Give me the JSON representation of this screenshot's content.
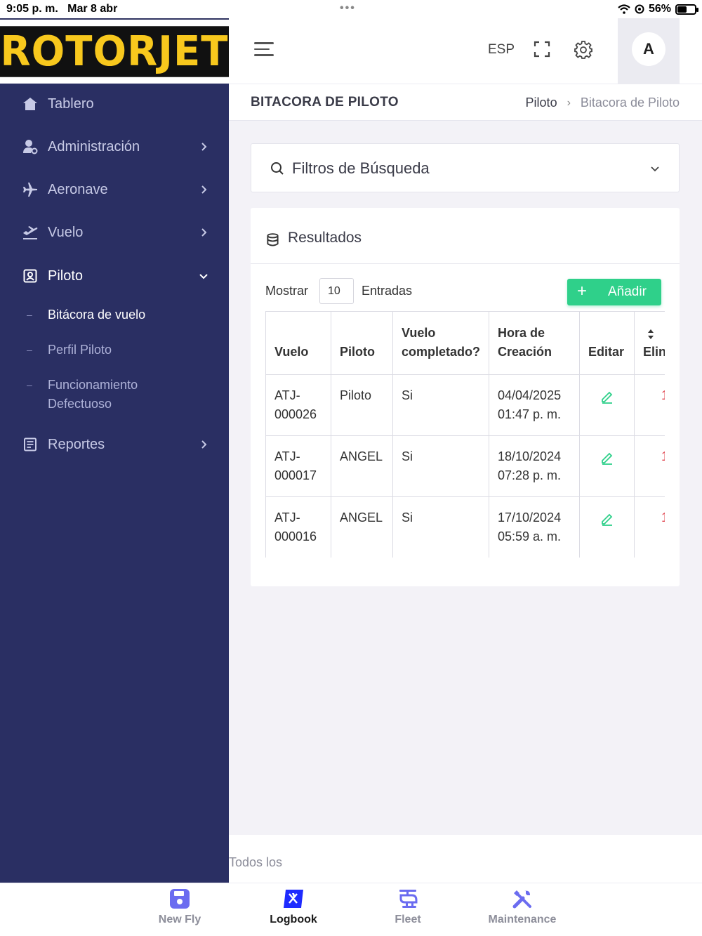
{
  "status_bar": {
    "time": "9:05 p. m.",
    "date": "Mar 8 abr",
    "battery": "56%",
    "battery_level": 0.56
  },
  "brand": {
    "logo_text": "ROTORJET"
  },
  "colors": {
    "sidebar_bg": "#2a2f63",
    "accent_green": "#2fd08a",
    "delete_red": "#e0454f",
    "tab_icon": "#6b6cf0"
  },
  "sidebar": {
    "items": [
      {
        "label": "Tablero",
        "icon": "home-icon",
        "has_children": false
      },
      {
        "label": "Administración",
        "icon": "user-settings-icon",
        "has_children": true
      },
      {
        "label": "Aeronave",
        "icon": "airplane-icon",
        "has_children": true
      },
      {
        "label": "Vuelo",
        "icon": "takeoff-icon",
        "has_children": true
      },
      {
        "label": "Piloto",
        "icon": "pilot-badge-icon",
        "has_children": true,
        "expanded": true
      },
      {
        "label": "Reportes",
        "icon": "report-icon",
        "has_children": true
      }
    ],
    "sub_items": [
      {
        "label": "Bitácora de vuelo",
        "active": true
      },
      {
        "label": "Perfil Piloto",
        "active": false
      },
      {
        "label": "Funcionamiento Defectuoso",
        "active": false
      }
    ]
  },
  "header": {
    "language": "ESP",
    "avatar_initial": "A"
  },
  "page": {
    "title": "BITACORA DE PILOTO",
    "breadcrumb": [
      "Piloto",
      "Bitacora de Piloto"
    ]
  },
  "filters": {
    "title": "Filtros de Búsqueda"
  },
  "results": {
    "title": "Resultados",
    "show_label": "Mostrar",
    "entries_value": "10",
    "entries_label": "Entradas",
    "add_button": "Añadir",
    "columns": [
      "Vuelo",
      "Piloto",
      "Vuelo completado?",
      "Hora de Creación",
      "Editar",
      "Elin"
    ],
    "rows": [
      {
        "vuelo": "ATJ-000026",
        "piloto": "Piloto",
        "completado": "Si",
        "hora": "04/04/2025 01:47 p. m.",
        "delete": "1"
      },
      {
        "vuelo": "ATJ-000017",
        "piloto": "ANGEL",
        "completado": "Si",
        "hora": "18/10/2024 07:28 p. m.",
        "delete": "1"
      },
      {
        "vuelo": "ATJ-000016",
        "piloto": "ANGEL",
        "completado": "Si",
        "hora": "17/10/2024 05:59 a. m.",
        "delete": "1"
      }
    ]
  },
  "footer_text": "Todos los",
  "tabbar": {
    "tabs": [
      {
        "label": "New Fly",
        "icon": "save-icon",
        "active": false
      },
      {
        "label": "Logbook",
        "icon": "logbook-icon",
        "active": true
      },
      {
        "label": "Fleet",
        "icon": "helicopter-icon",
        "active": false
      },
      {
        "label": "Maintenance",
        "icon": "tools-icon",
        "active": false
      }
    ]
  }
}
